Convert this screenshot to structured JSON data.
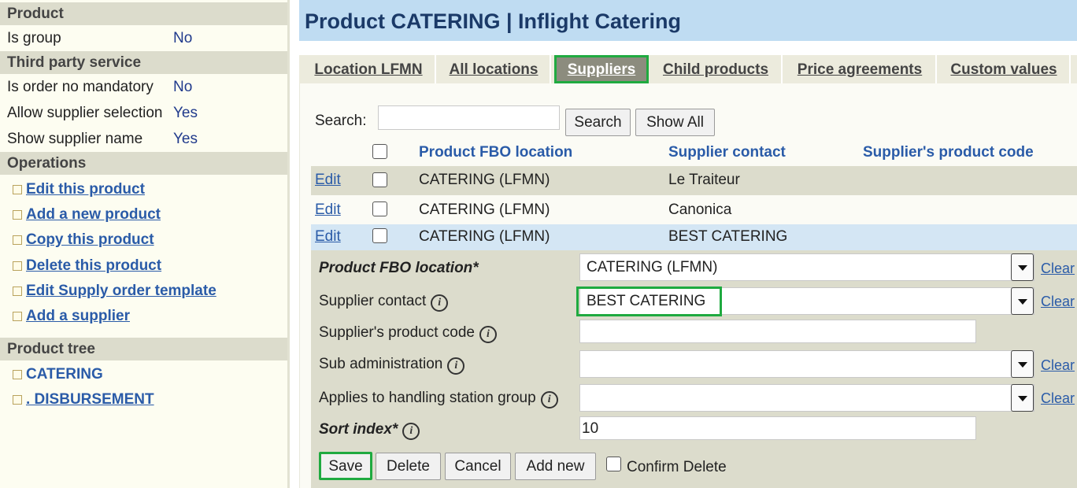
{
  "sidebar": {
    "product": {
      "heading": "Product",
      "rows": [
        {
          "label": "Is group",
          "value": "No"
        }
      ]
    },
    "third_party": {
      "heading": "Third party service",
      "rows": [
        {
          "label": "Is order no mandatory",
          "value": "No"
        },
        {
          "label": "Allow supplier selection",
          "value": "Yes"
        },
        {
          "label": "Show supplier name",
          "value": "Yes"
        }
      ]
    },
    "operations": {
      "heading": "Operations",
      "links": [
        "Edit this product",
        "Add a new product",
        "Copy this product",
        "Delete this product",
        "Edit Supply order template",
        "Add a supplier"
      ]
    },
    "tree": {
      "heading": "Product tree",
      "items": [
        "CATERING",
        ". DISBURSEMENT"
      ]
    }
  },
  "header": {
    "title": "Product CATERING | Inflight Catering"
  },
  "tabs": [
    {
      "label": "Location LFMN",
      "active": false
    },
    {
      "label": "All locations",
      "active": false
    },
    {
      "label": "Suppliers",
      "active": true
    },
    {
      "label": "Child products",
      "active": false
    },
    {
      "label": "Price agreements",
      "active": false
    },
    {
      "label": "Custom values",
      "active": false
    }
  ],
  "search": {
    "label": "Search:",
    "value": "",
    "search_button": "Search",
    "show_all_button": "Show All"
  },
  "table": {
    "columns": [
      "Product FBO location",
      "Supplier contact",
      "Supplier's product code"
    ],
    "edit_label": "Edit",
    "rows": [
      {
        "location": "CATERING (LFMN)",
        "contact": "Le Traiteur",
        "code": ""
      },
      {
        "location": "CATERING (LFMN)",
        "contact": "Canonica",
        "code": ""
      },
      {
        "location": "CATERING (LFMN)",
        "contact": "BEST CATERING",
        "code": ""
      }
    ]
  },
  "form": {
    "clear_label": "Clear",
    "fbo_location": {
      "label": "Product FBO location*",
      "value": "CATERING (LFMN)"
    },
    "supplier_contact": {
      "label": "Supplier contact",
      "value": "BEST CATERING"
    },
    "product_code": {
      "label": "Supplier's product code",
      "value": ""
    },
    "sub_admin": {
      "label": "Sub administration",
      "value": ""
    },
    "station_group": {
      "label": "Applies to handling station group",
      "value": ""
    },
    "sort_index": {
      "label": "Sort index*",
      "value": "10"
    },
    "buttons": {
      "save": "Save",
      "delete": "Delete",
      "cancel": "Cancel",
      "add_new": "Add new"
    },
    "confirm_delete": "Confirm Delete"
  },
  "colors": {
    "accent_link": "#2a5ba8",
    "highlight": "#1faa40",
    "header_bg": "#bfdcf2",
    "title": "#1b3a68"
  }
}
